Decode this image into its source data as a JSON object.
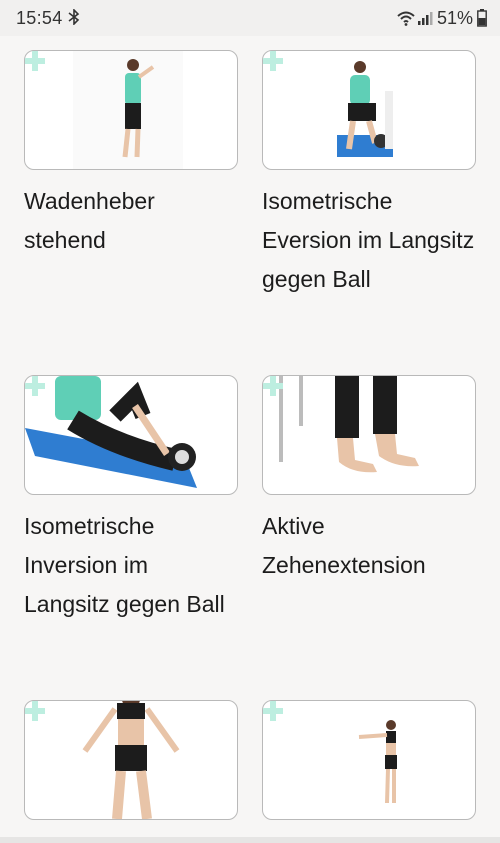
{
  "status_bar": {
    "time": "15:54",
    "battery_percent": "51%",
    "icons": [
      "bluetooth-icon",
      "wifi-icon",
      "signal-icon",
      "battery-icon"
    ]
  },
  "exercises": [
    {
      "title": "Wadenheber stehend",
      "image": "person-standing-calf-raise"
    },
    {
      "title": "Isometrische Eversion im Langsitz gegen Ball",
      "image": "person-long-sitting-ball-eversion"
    },
    {
      "title": "Isometrische Inversion im Langsitz gegen Ball",
      "image": "person-long-sitting-ball-inversion"
    },
    {
      "title": "Aktive Zehenextension",
      "image": "feet-toe-extension"
    },
    {
      "title": "",
      "image": "person-standing-arms-out"
    },
    {
      "title": "",
      "image": "person-standing-arms-forward"
    }
  ],
  "colors": {
    "background": "#f7f6f5",
    "card_border": "#b9b9b9",
    "plus_accent": "#bdeee0",
    "text": "#1c1c1c"
  }
}
